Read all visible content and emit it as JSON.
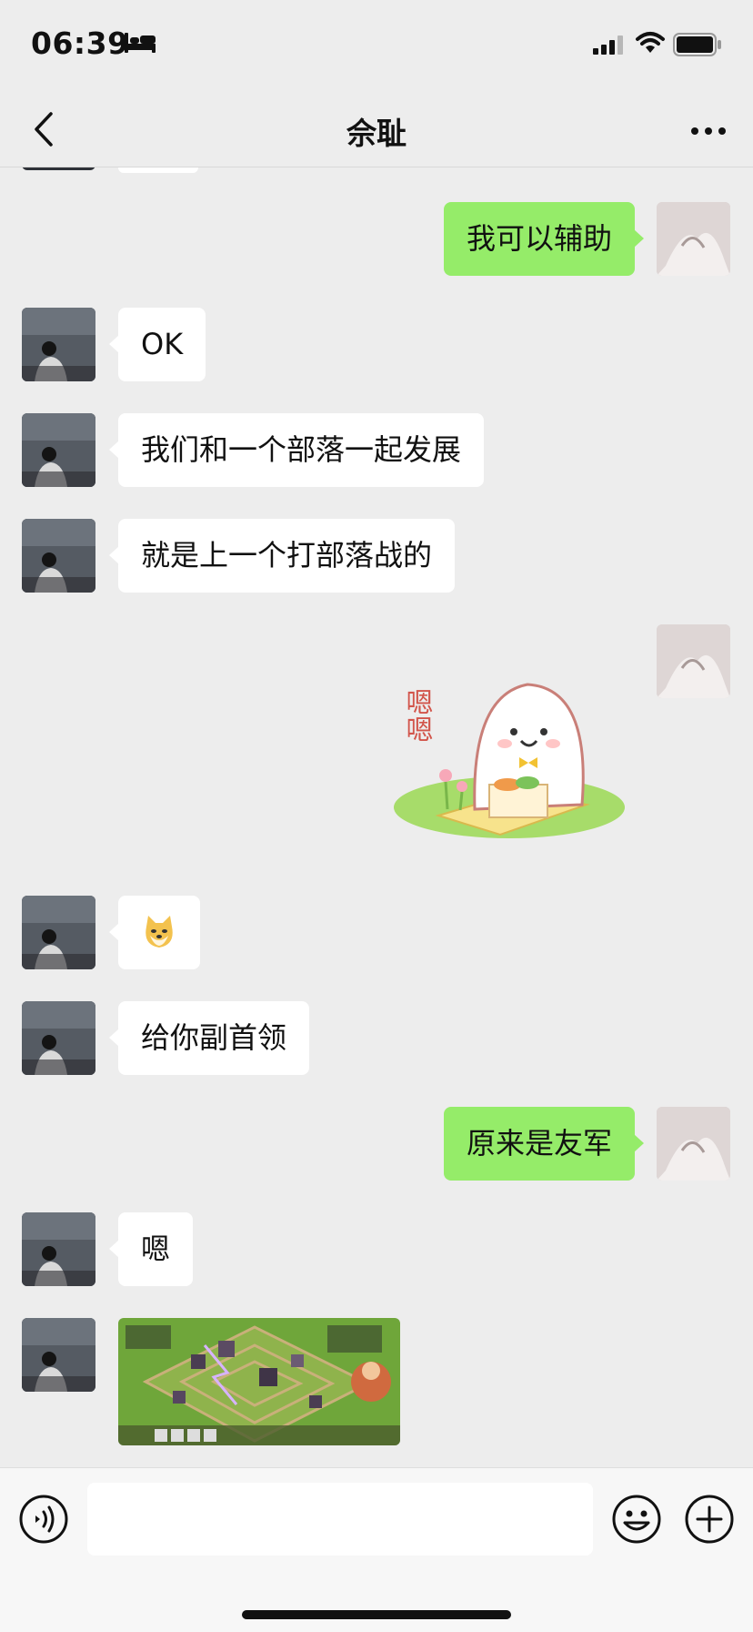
{
  "status_bar": {
    "time": "06:39"
  },
  "header": {
    "title": "佘耻"
  },
  "messages": [
    {
      "side": "right",
      "type": "text",
      "text": "我可以辅助"
    },
    {
      "side": "left",
      "type": "text",
      "text": "OK"
    },
    {
      "side": "left",
      "type": "text",
      "text": "我们和一个部落一起发展"
    },
    {
      "side": "left",
      "type": "text",
      "text": "就是上一个打部落战的"
    },
    {
      "side": "right",
      "type": "sticker",
      "text": "嗯嗯"
    },
    {
      "side": "left",
      "type": "emoji",
      "icon": "doge-emoji-icon"
    },
    {
      "side": "left",
      "type": "text",
      "text": "给你副首领"
    },
    {
      "side": "right",
      "type": "text",
      "text": "原来是友军"
    },
    {
      "side": "left",
      "type": "text",
      "text": "嗯"
    },
    {
      "side": "left",
      "type": "image",
      "description_icon": "game-screenshot"
    }
  ],
  "colors": {
    "background": "#ededed",
    "my_bubble": "#95ec69",
    "their_bubble": "#ffffff"
  }
}
